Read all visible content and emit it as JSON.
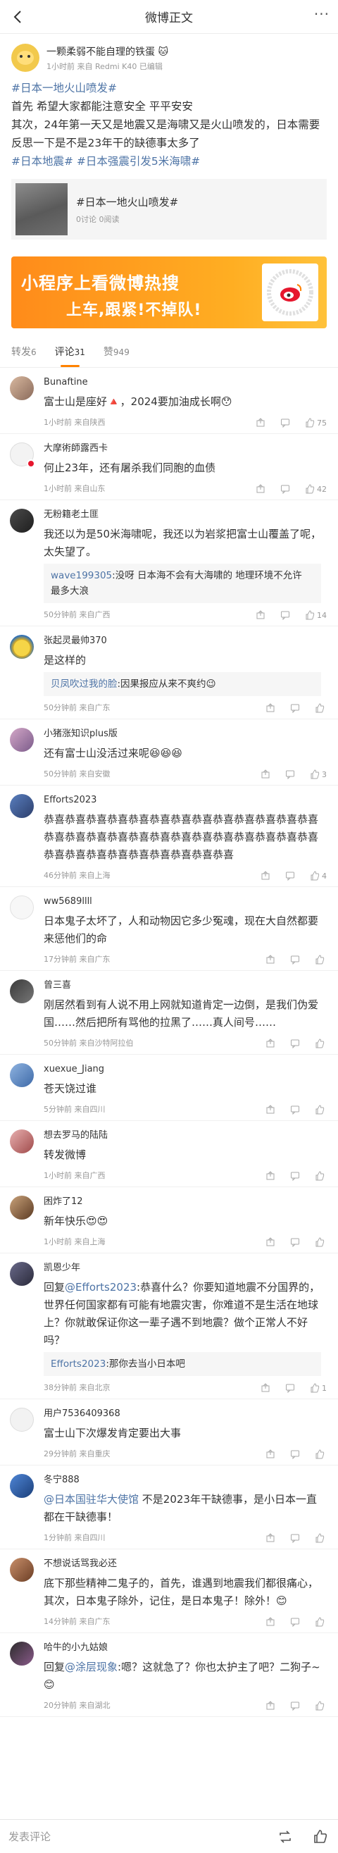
{
  "header": {
    "title": "微博正文",
    "more": "···"
  },
  "post": {
    "author": "一颗柔弱不能自理的铁蛋",
    "meta": "1小时前 来自 Redmi K40 已编辑",
    "line1_tag": "#日本一地火山喷发#",
    "line2": "首先 希望大家都能注意安全 平平安安",
    "line3": "其次，24年第一天又是地震又是海啸又是火山喷发的，日本需要反思一下是不是23年干的缺德事太多了",
    "tag2": "#日本地震#",
    "tag3": "#日本强震引发5米海啸#",
    "card_title": "#日本一地火山喷发#",
    "card_sub": "0讨论 0阅读"
  },
  "banner": {
    "line1": "小程序上看微博热搜",
    "line2": "上车,跟紧!不掉队!"
  },
  "tabs": [
    {
      "label": "转发",
      "count": "6"
    },
    {
      "label": "评论",
      "count": "31"
    },
    {
      "label": "赞",
      "count": "949"
    }
  ],
  "comments": [
    {
      "name": "Bunaftine",
      "text": "富士山是座好🔺，2024要加油成长啊😯",
      "meta": "1小时前 来自陕西",
      "likes": "75"
    },
    {
      "name": "大摩術師露西卡",
      "text": "何止23年，还有屠杀我们同胞的血债",
      "meta": "1小时前 来自山东",
      "likes": "42"
    },
    {
      "name": "无粉籍老土匪",
      "text": "我还以为是50米海啸呢，我还以为岩浆把富士山覆盖了呢，太失望了。",
      "reply_user": "wave199305",
      "reply_text": ":没呀 日本海不会有大海啸的 地理环境不允许 最多大浪",
      "meta": "50分钟前 来自广西",
      "likes": "14"
    },
    {
      "name": "张起灵最帅370",
      "text": "是这样的",
      "reply_user": "贝凤吹过我的脸",
      "reply_text": ":因果报应从来不爽约😉",
      "meta": "50分钟前 来自广东",
      "likes": ""
    },
    {
      "name": "小猪涨知识plus版",
      "text": "还有富士山没活过来呢😆😆😆",
      "meta": "50分钟前 来自安徽",
      "likes": "3"
    },
    {
      "name": "Efforts2023",
      "text": "恭喜恭喜恭喜恭喜恭喜恭喜恭喜恭喜恭喜恭喜恭喜恭喜恭喜恭喜恭喜恭喜恭喜恭喜恭喜恭喜恭喜恭喜恭喜恭喜恭喜恭喜恭喜恭喜恭喜恭喜恭喜恭喜恭喜恭喜恭喜",
      "meta": "46分钟前 来自上海",
      "likes": "4"
    },
    {
      "name": "ww5689llll",
      "text": "日本鬼子太坏了，人和动物因它多少冤魂，现在大自然都要来惩他们的命",
      "meta": "17分钟前 来自广东",
      "likes": ""
    },
    {
      "name": "曾三喜",
      "text": "刚居然看到有人说不用上网就知道肯定一边倒，是我们伪爱国……然后把所有骂他的拉黑了……真人间号……",
      "meta": "50分钟前 来自沙特阿拉伯",
      "likes": ""
    },
    {
      "name": "xuexue_Jiang",
      "text": "苍天饶过谁",
      "meta": "5分钟前 来自四川",
      "likes": ""
    },
    {
      "name": "想去罗马的陆陆",
      "text": "转发微博",
      "meta": "1小时前 来自广西",
      "likes": ""
    },
    {
      "name": "困炸了12",
      "text": "新年快乐😍😍",
      "meta": "1小时前 来自上海",
      "likes": ""
    },
    {
      "name": "凯恩少年",
      "text_prefix": "回复",
      "at_user": "@Efforts2023",
      "text": ":恭喜什么？你要知道地震不分国界的，世界任何国家都有可能有地震灾害，你难道不是生活在地球上？你就敢保证你这一辈子遇不到地震？做个正常人不好吗？",
      "reply_user": "Efforts2023",
      "reply_text": ":那你去当小日本吧",
      "meta": "38分钟前 来自北京",
      "likes": "1"
    },
    {
      "name": "用户7536409368",
      "text": "富士山下次爆发肯定要出大事",
      "meta": "29分钟前 来自重庆",
      "likes": ""
    },
    {
      "name": "冬宁888",
      "at_user": "@日本国驻华大使馆",
      "text": " 不是2023年干缺德事，是小日本一直都在干缺德事！",
      "meta": "1分钟前 来自四川",
      "likes": ""
    },
    {
      "name": "不想说话骂我必还",
      "text": "底下那些精神二鬼子的，首先，谁遇到地震我们都很痛心，其次，日本鬼子除外，记住，是日本鬼子！除外！😊",
      "meta": "14分钟前 来自广东",
      "likes": ""
    },
    {
      "name": "哈牛的小九姑娘",
      "text_prefix": "回复",
      "at_user": "@涂层现象",
      "text": ":嗯？这就急了？你也太护主了吧？二狗子~😊",
      "meta": "20分钟前 来自湖北",
      "likes": ""
    }
  ],
  "bottom": {
    "placeholder": "发表评论"
  }
}
